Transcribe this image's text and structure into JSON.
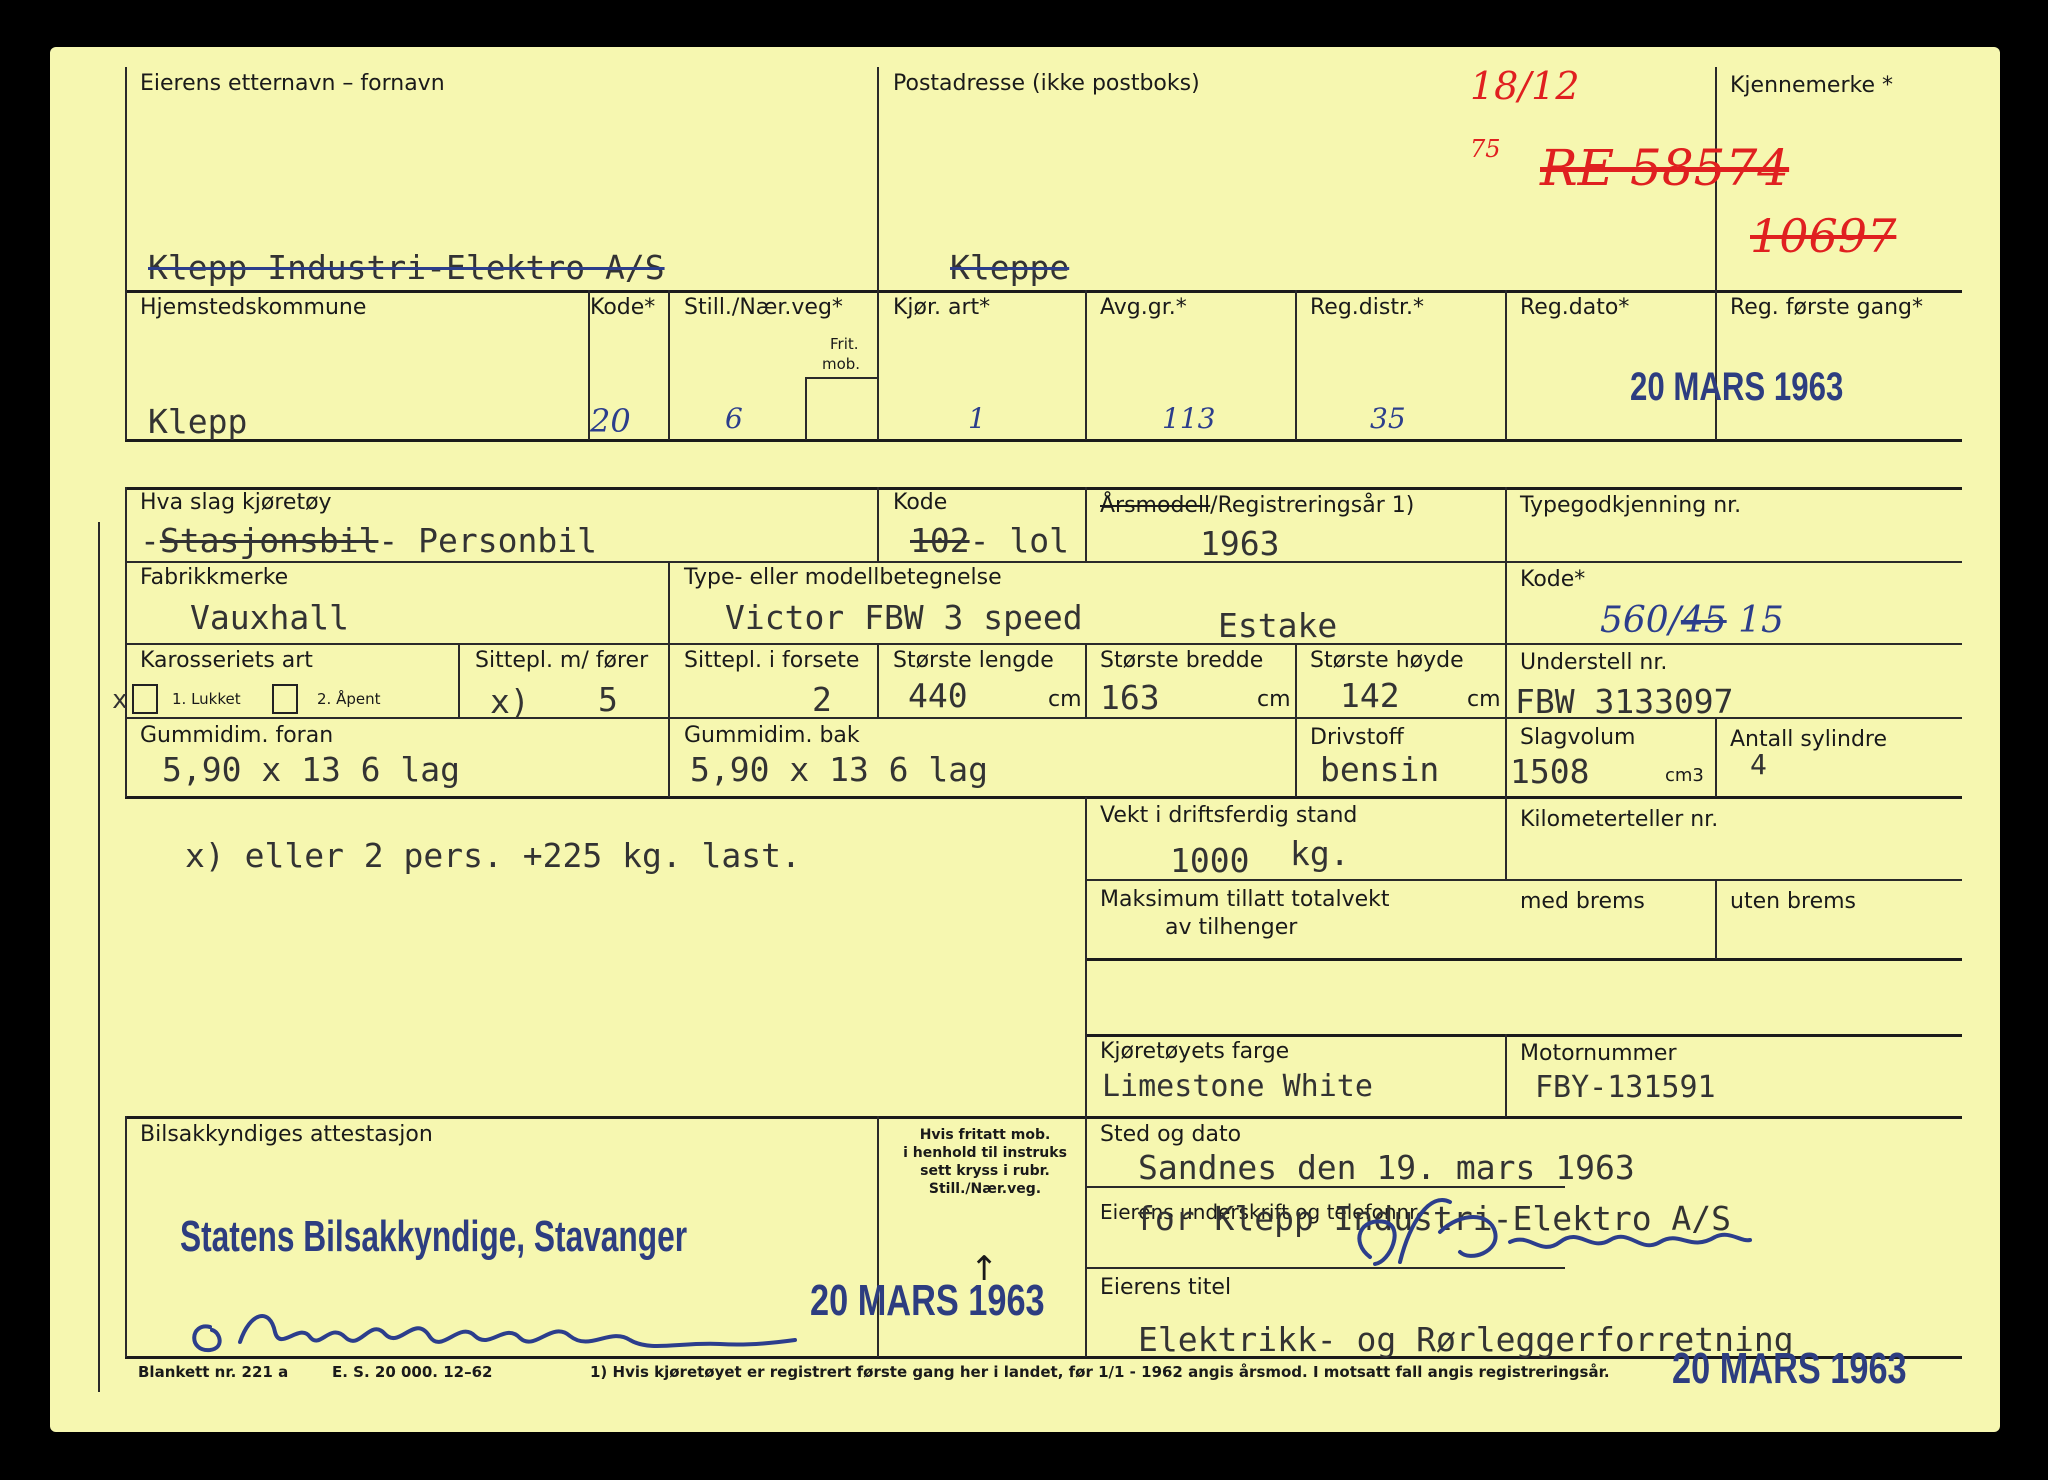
{
  "header": {
    "owner_label": "Eierens etternavn – fornavn",
    "owner_value": "Klepp Industri-Elektro A/S",
    "address_label": "Postadresse (ikke postboks)",
    "address_value": "Kleppe",
    "plate_label": "Kjennemerke *",
    "plate_date": "18/12",
    "plate_year": "75",
    "plate_value": "RE 58574",
    "plate_old": "10697"
  },
  "row2": {
    "municipality_label": "Hjemstedskommune",
    "municipality_value": "Klepp",
    "code_label": "Kode*",
    "code_value": "20",
    "still_label": "Still./Nær.veg*",
    "still_value": "6",
    "frit_label_1": "Frit.",
    "frit_label_2": "mob.",
    "kjor_label": "Kjør. art*",
    "kjor_value": "1",
    "avg_label": "Avg.gr.*",
    "avg_value": "113",
    "regdistr_label": "Reg.distr.*",
    "regdistr_value": "35",
    "regdato_label": "Reg.dato*",
    "regdato_stamp": "20 MARS 1963",
    "first_reg_label": "Reg. første gang*"
  },
  "vehicle": {
    "type_label": "Hva slag kjøretøy",
    "type_old": "Stasjonsbil",
    "type_value": "Personbil",
    "kode_label": "Kode",
    "kode_old": "102",
    "kode_value": "lol",
    "year_label_strike": "Årsmodell",
    "year_label_rest": "/Registreringsår 1)",
    "year_value": "1963",
    "typegodkj_label": "Typegodkjenning nr.",
    "make_label": "Fabrikkmerke",
    "make_value": "Vauxhall",
    "model_label": "Type- eller modellbetegnelse",
    "model_value": "Victor FBW 3 speed",
    "model_extra": "Estake",
    "kode2_label": "Kode*",
    "kode2_value": "560/",
    "kode2_old": "45",
    "kode2_new": "15",
    "body_label": "Karosseriets art",
    "body_opt1": "1. Lukket",
    "body_opt2": "2. Åpent",
    "body_mark": "x",
    "seats_label": "Sittepl. m/ fører",
    "seats_prefix": "x)",
    "seats_value": "5",
    "front_seats_label": "Sittepl. i forsete",
    "front_seats_value": "2",
    "length_label": "Største lengde",
    "length_value": "440",
    "width_label": "Største bredde",
    "width_value": "163",
    "height_label": "Største høyde",
    "height_value": "142",
    "unit_cm": "cm",
    "chassis_label": "Understell nr.",
    "chassis_value": "FBW 3133097",
    "tire_front_label": "Gummidim. foran",
    "tire_front_value": "5,90 x 13 6 lag",
    "tire_rear_label": "Gummidim. bak",
    "tire_rear_value": "5,90 x 13 6 lag",
    "fuel_label": "Drivstoff",
    "fuel_value": "bensin",
    "volume_label": "Slagvolum",
    "volume_value": "1508",
    "volume_unit": "cm3",
    "cyl_label": "Antall sylindre",
    "cyl_value": "4"
  },
  "load": {
    "note": "x) eller 2 pers. +225 kg. last.",
    "weight_label": "Vekt i driftsferdig stand",
    "weight_value": "1000",
    "weight_unit": "kg.",
    "km_label": "Kilometerteller nr.",
    "max_label_1": "Maksimum tillatt totalvekt",
    "max_label_2": "av tilhenger",
    "brake_with": "med brems",
    "brake_without": "uten brems"
  },
  "color": {
    "color_label": "Kjøretøyets farge",
    "color_value": "Limestone White",
    "engine_label": "Motornummer",
    "engine_value": "FBY-131591"
  },
  "attest": {
    "label": "Bilsakkyndiges attestasjon",
    "org": "Statens Bilsakkyndige, Stavanger",
    "exempt_1": "Hvis fritatt mob.",
    "exempt_2": "i henhold til instruks",
    "exempt_3": "sett kryss i rubr.",
    "exempt_4": "Still./Nær.veg.",
    "arrow": "↑",
    "stamp": "20 MARS 1963",
    "place_label": "Sted og dato",
    "place_value": "Sandnes den 19. mars 1963",
    "sign_label": "Eierens underskrift og telefonnr.",
    "sign_value": "for Klepp Industri-Elektro A/S",
    "title_label": "Eierens titel",
    "title_value": "Elektrikk- og Rørleggerforretning",
    "bottom_stamp": "20 MARS 1963"
  },
  "footer": {
    "form_no": "Blankett nr. 221 a",
    "print": "E. S. 20 000. 12–62",
    "note": "1)  Hvis kjøretøyet er registrert første gang her i landet, før 1/1 - 1962 angis årsmod.  I motsatt fall angis registreringsår."
  }
}
